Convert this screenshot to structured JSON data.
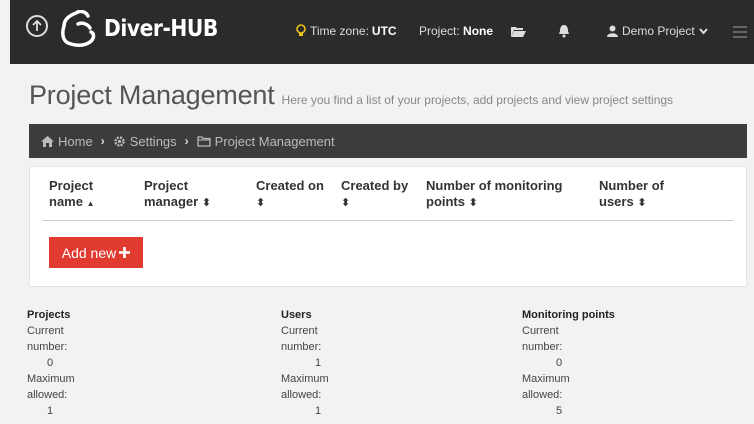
{
  "nav": {
    "app_name": "Diver-HUB",
    "timezone_label": "Time zone:",
    "timezone_value": "UTC",
    "project_label": "Project:",
    "project_value": "None",
    "user_label": "Demo Project"
  },
  "page": {
    "title": "Project Management",
    "subtitle": "Here you find a list of your projects, add projects and view project settings"
  },
  "breadcrumb": {
    "home": "Home",
    "settings": "Settings",
    "current": "Project Management"
  },
  "table": {
    "headers": [
      {
        "line1": "Project",
        "line2": "name",
        "sort": "▲"
      },
      {
        "line1": "Project",
        "line2": "manager",
        "sort": "⬍"
      },
      {
        "line1": "Created on",
        "line2": "",
        "sort": "⬍"
      },
      {
        "line1": "Created by",
        "line2": "",
        "sort": "⬍"
      },
      {
        "line1": "Number of monitoring",
        "line2": "points",
        "sort": "⬍"
      },
      {
        "line1": "Number of",
        "line2": "users",
        "sort": "⬍"
      }
    ],
    "add_button": "Add new"
  },
  "stats": [
    {
      "title": "Projects",
      "current_label_1": "Current",
      "current_label_2": "number:",
      "current_value": "0",
      "max_label_1": "Maximum",
      "max_label_2": "allowed:",
      "max_value": "1"
    },
    {
      "title": "Users",
      "current_label_1": "Current",
      "current_label_2": "number:",
      "current_value": "1",
      "max_label_1": "Maximum",
      "max_label_2": "allowed:",
      "max_value": "1"
    },
    {
      "title": "Monitoring points",
      "current_label_1": "Current",
      "current_label_2": "number:",
      "current_value": "0",
      "max_label_1": "Maximum",
      "max_label_2": "allowed:",
      "max_value": "5"
    }
  ],
  "colors": {
    "navbar": "#2b2b2b",
    "breadcrumb": "#3c3c3c",
    "accent_red": "#e03a31",
    "lightbulb": "#f0c419"
  },
  "icons": [
    "upload-icon",
    "logo-icon",
    "lightbulb-icon",
    "folder-open-icon",
    "bell-icon",
    "user-icon",
    "chevron-down-icon",
    "hamburger-icon",
    "home-icon",
    "gear-icon",
    "folder-icon",
    "plus-icon"
  ]
}
